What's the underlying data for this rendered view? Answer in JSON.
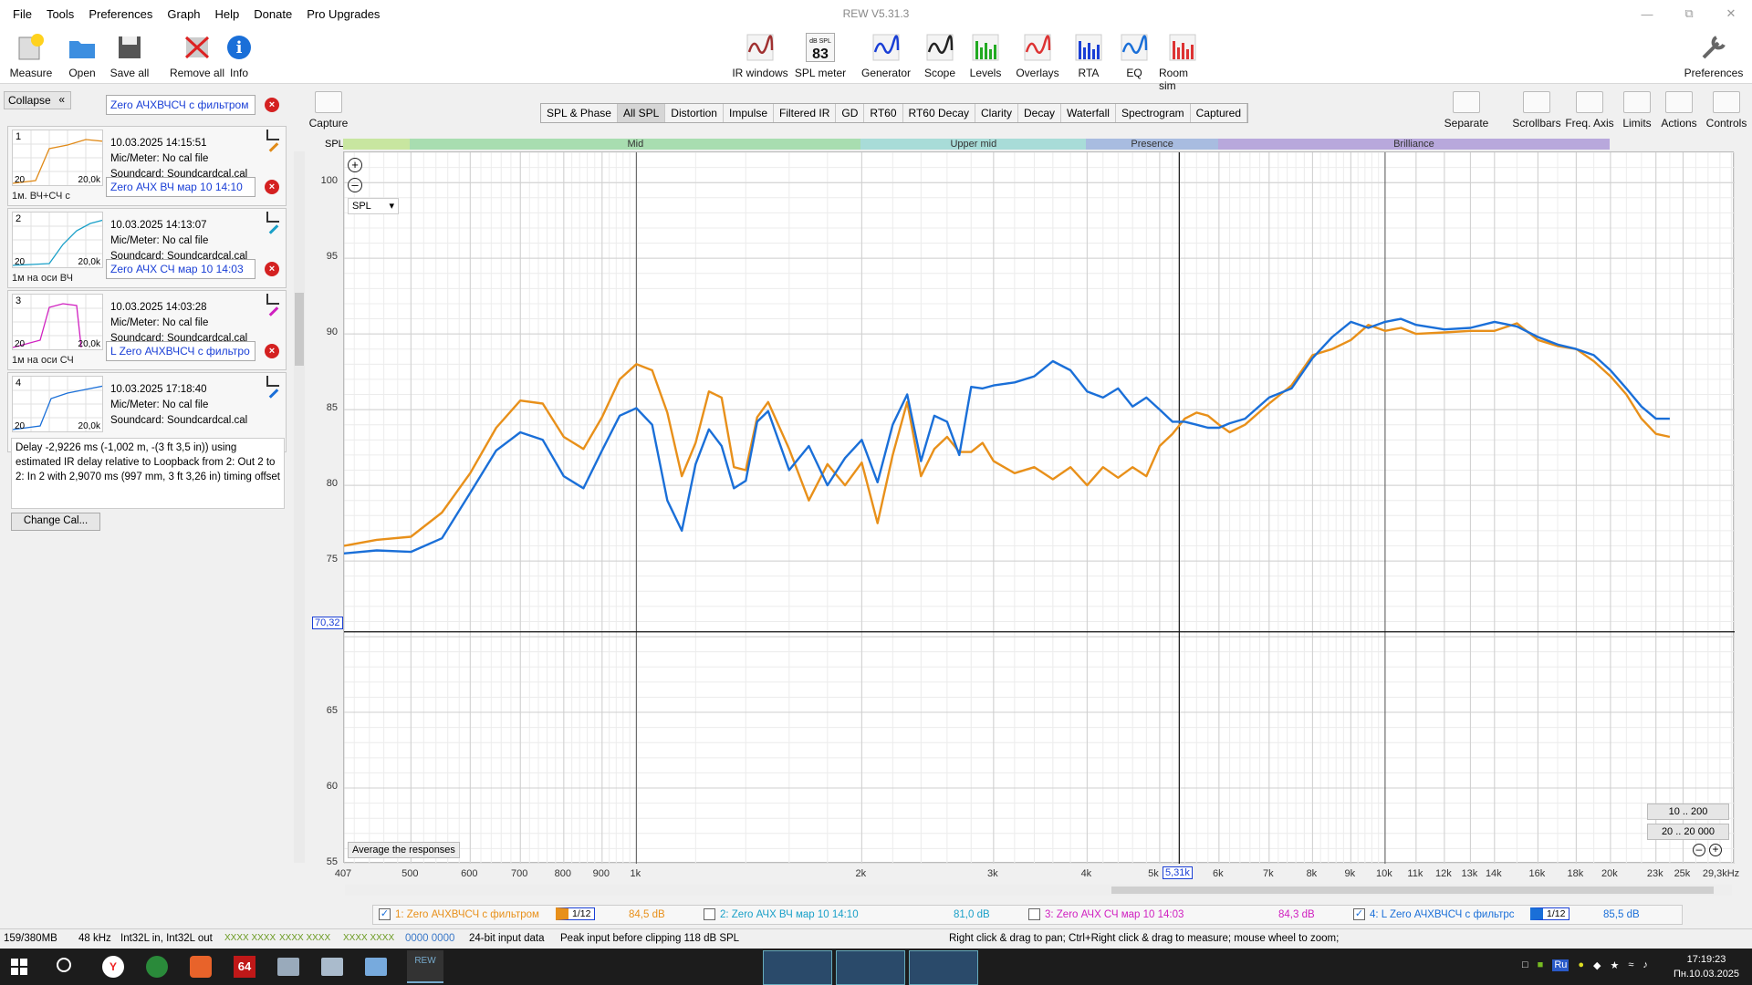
{
  "menu": [
    "File",
    "Tools",
    "Preferences",
    "Graph",
    "Help",
    "Donate",
    "Pro Upgrades"
  ],
  "window_title": "REW V5.31.3",
  "toolbar_left": [
    {
      "label": "Measure",
      "icon": "measure-icon"
    },
    {
      "label": "Open",
      "icon": "folder-icon"
    },
    {
      "label": "Save all",
      "icon": "save-icon"
    },
    {
      "label": "Remove all",
      "icon": "remove-icon"
    },
    {
      "label": "Info",
      "icon": "info-icon"
    }
  ],
  "toolbar_center": [
    {
      "label": "IR windows",
      "icon": "ir-windows-icon"
    },
    {
      "label": "SPL meter",
      "icon": "spl-meter-icon",
      "badge": "83",
      "badge_unit": "dB SPL"
    },
    {
      "label": "Generator",
      "icon": "generator-icon"
    },
    {
      "label": "Scope",
      "icon": "scope-icon"
    },
    {
      "label": "Levels",
      "icon": "levels-icon"
    },
    {
      "label": "Overlays",
      "icon": "overlays-icon"
    },
    {
      "label": "RTA",
      "icon": "rta-icon"
    },
    {
      "label": "EQ",
      "icon": "eq-icon"
    },
    {
      "label": "Room sim",
      "icon": "room-sim-icon"
    }
  ],
  "toolbar_right": {
    "label": "Preferences",
    "icon": "wrench-icon"
  },
  "graph_tools": [
    {
      "label": "Capture",
      "icon": "camera-icon"
    },
    {
      "label": "Separate",
      "icon": "separate-icon"
    },
    {
      "label": "Scrollbars",
      "icon": "scrollbars-icon"
    },
    {
      "label": "Freq. Axis",
      "icon": "freq-axis-icon"
    },
    {
      "label": "Limits",
      "icon": "limits-icon"
    },
    {
      "label": "Actions",
      "icon": "actions-icon"
    },
    {
      "label": "Controls",
      "icon": "gear-icon"
    }
  ],
  "collapse_label": "Collapse",
  "measurements": [
    {
      "num": "1",
      "name": "Zero АЧХВЧСЧ с фильтром",
      "date": "10.03.2025 14:15:51",
      "mic": "Mic/Meter: No cal file",
      "sound": "Soundcard: Soundcardcal.cal",
      "sub": "1м. ВЧ+СЧ с",
      "color": "#e08a18",
      "thumb_lo": "20",
      "thumb_hi": "20,0k"
    },
    {
      "num": "2",
      "name": "Zero АЧХ ВЧ мар 10 14:10",
      "date": "10.03.2025 14:13:07",
      "mic": "Mic/Meter: No cal file",
      "sound": "Soundcard: Soundcardcal.cal",
      "sub": "1м на оси ВЧ",
      "color": "#1aa0c8",
      "thumb_lo": "20",
      "thumb_hi": "20,0k"
    },
    {
      "num": "3",
      "name": "Zero АЧХ СЧ мар 10 14:03",
      "date": "10.03.2025 14:03:28",
      "mic": "Mic/Meter: No cal file",
      "sound": "Soundcard: Soundcardcal.cal",
      "sub": "1м на оси СЧ",
      "color": "#d020c0",
      "thumb_lo": "20",
      "thumb_hi": "20,0k"
    },
    {
      "num": "4",
      "name": "L Zero АЧХВЧСЧ с фильтро",
      "date": "10.03.2025 17:18:40",
      "mic": "Mic/Meter: No cal file",
      "sound": "Soundcard: Soundcardcal.cal",
      "sub": "",
      "color": "#1a6fd8",
      "thumb_lo": "20",
      "thumb_hi": "20,0k"
    }
  ],
  "delay_text": "Delay -2,9226 ms (-1,002 m, -(3 ft 3,5 in)) using estimated IR delay relative to Loopback from 2: Out 2 to 2: In 2 with 2,9070 ms (997 mm, 3 ft 3,26 in) timing offset",
  "change_cal": "Change Cal...",
  "tabs": [
    "SPL & Phase",
    "All SPL",
    "Distortion",
    "Impulse",
    "Filtered IR",
    "GD",
    "RT60",
    "RT60 Decay",
    "Clarity",
    "Decay",
    "Waterfall",
    "Spectrogram",
    "Captured"
  ],
  "active_tab": "All SPL",
  "spl_label": "SPL",
  "spl_select": "SPL",
  "bands": [
    {
      "label": "",
      "from": 407,
      "to": 500,
      "color": "#c8e6a0"
    },
    {
      "label": "Mid",
      "from": 500,
      "to": 2000,
      "color": "#a8ddb0"
    },
    {
      "label": "Upper mid",
      "from": 2000,
      "to": 4000,
      "color": "#a8dcd8"
    },
    {
      "label": "Presence",
      "from": 4000,
      "to": 6000,
      "color": "#a8bce0"
    },
    {
      "label": "Brilliance",
      "from": 6000,
      "to": 20000,
      "color": "#b8a8dc"
    }
  ],
  "cursor_y": "70,32",
  "cursor_x": "5,31k",
  "avg_button": "Average the responses",
  "range_buttons": [
    "10 .. 200",
    "20 .. 20 000"
  ],
  "chart_data": {
    "type": "line",
    "xlabel": "",
    "ylabel": "",
    "x_scale": "log",
    "xlim": [
      407,
      29300
    ],
    "ylim": [
      55,
      102
    ],
    "y_ticks": [
      55,
      60,
      65,
      70,
      75,
      80,
      85,
      90,
      95,
      100
    ],
    "x_ticks": [
      {
        "v": 407,
        "t": "407"
      },
      {
        "v": 500,
        "t": "500"
      },
      {
        "v": 600,
        "t": "600"
      },
      {
        "v": 700,
        "t": "700"
      },
      {
        "v": 800,
        "t": "800"
      },
      {
        "v": 900,
        "t": "900"
      },
      {
        "v": 1000,
        "t": "1k"
      },
      {
        "v": 2000,
        "t": "2k"
      },
      {
        "v": 3000,
        "t": "3k"
      },
      {
        "v": 4000,
        "t": "4k"
      },
      {
        "v": 5000,
        "t": "5k"
      },
      {
        "v": 6000,
        "t": "6k"
      },
      {
        "v": 7000,
        "t": "7k"
      },
      {
        "v": 8000,
        "t": "8k"
      },
      {
        "v": 9000,
        "t": "9k"
      },
      {
        "v": 10000,
        "t": "10k"
      },
      {
        "v": 11000,
        "t": "11k"
      },
      {
        "v": 12000,
        "t": "12k"
      },
      {
        "v": 13000,
        "t": "13k"
      },
      {
        "v": 14000,
        "t": "14k"
      },
      {
        "v": 16000,
        "t": "16k"
      },
      {
        "v": 18000,
        "t": "18k"
      },
      {
        "v": 20000,
        "t": "20k"
      },
      {
        "v": 23000,
        "t": "23k"
      },
      {
        "v": 25000,
        "t": "25k"
      },
      {
        "v": 29300,
        "t": "29,3kHz"
      }
    ],
    "series": [
      {
        "name": "1: Zero АЧХВЧСЧ с фильтром",
        "color": "#e8901a",
        "x": [
          407,
          450,
          500,
          550,
          600,
          650,
          700,
          750,
          800,
          850,
          900,
          950,
          1000,
          1050,
          1100,
          1150,
          1200,
          1250,
          1300,
          1350,
          1400,
          1450,
          1500,
          1600,
          1700,
          1800,
          1900,
          2000,
          2100,
          2200,
          2300,
          2400,
          2500,
          2600,
          2700,
          2800,
          2900,
          3000,
          3200,
          3400,
          3600,
          3800,
          4000,
          4200,
          4400,
          4600,
          4800,
          5000,
          5200,
          5400,
          5600,
          5800,
          6000,
          6200,
          6500,
          7000,
          7500,
          8000,
          8500,
          9000,
          9500,
          10000,
          10500,
          11000,
          12000,
          13000,
          14000,
          15000,
          16000,
          17000,
          18000,
          19000,
          20000,
          21000,
          22000,
          23000,
          24000
        ],
        "y": [
          76.0,
          76.4,
          76.6,
          78.2,
          80.8,
          83.8,
          85.6,
          85.4,
          83.2,
          82.4,
          84.5,
          87.0,
          88.0,
          87.6,
          84.8,
          80.6,
          82.8,
          86.2,
          85.8,
          81.2,
          81.0,
          84.5,
          85.5,
          82.4,
          79.0,
          81.4,
          80.0,
          81.5,
          77.5,
          82.0,
          85.5,
          80.6,
          82.4,
          83.2,
          82.2,
          82.2,
          82.8,
          81.6,
          80.8,
          81.2,
          80.4,
          81.2,
          80.0,
          81.2,
          80.5,
          81.2,
          80.6,
          82.6,
          83.4,
          84.4,
          84.8,
          84.6,
          84.0,
          83.5,
          84.0,
          85.4,
          86.6,
          88.6,
          89.0,
          89.6,
          90.6,
          90.2,
          90.4,
          90.0,
          90.1,
          90.2,
          90.2,
          90.7,
          89.6,
          89.2,
          89.0,
          88.2,
          87.2,
          86.0,
          84.4,
          83.4,
          83.2
        ]
      },
      {
        "name": "4: L Zero АЧХВЧСЧ с фильтро",
        "color": "#1a6fd8",
        "x": [
          407,
          450,
          500,
          550,
          600,
          650,
          700,
          750,
          800,
          850,
          900,
          950,
          1000,
          1050,
          1100,
          1150,
          1200,
          1250,
          1300,
          1350,
          1400,
          1450,
          1500,
          1600,
          1700,
          1800,
          1900,
          2000,
          2100,
          2200,
          2300,
          2400,
          2500,
          2600,
          2700,
          2800,
          2900,
          3000,
          3200,
          3400,
          3600,
          3800,
          4000,
          4200,
          4400,
          4600,
          4800,
          5000,
          5200,
          5400,
          5600,
          5800,
          6000,
          6200,
          6500,
          7000,
          7500,
          8000,
          8500,
          9000,
          9500,
          10000,
          10500,
          11000,
          12000,
          13000,
          14000,
          15000,
          16000,
          17000,
          18000,
          19000,
          20000,
          21000,
          22000,
          23000,
          24000
        ],
        "y": [
          75.5,
          75.7,
          75.6,
          76.5,
          79.5,
          82.3,
          83.5,
          83.0,
          80.6,
          79.8,
          82.3,
          84.6,
          85.1,
          84.0,
          79.0,
          77.0,
          81.4,
          83.7,
          82.6,
          79.8,
          80.3,
          84.2,
          84.9,
          81.0,
          82.6,
          80.0,
          81.8,
          83.0,
          80.2,
          84.0,
          86.0,
          81.6,
          84.6,
          84.2,
          82.0,
          86.5,
          86.4,
          86.6,
          86.8,
          87.2,
          88.2,
          87.6,
          86.2,
          85.8,
          86.4,
          85.2,
          85.8,
          85.0,
          84.2,
          84.2,
          84.0,
          83.8,
          83.8,
          84.1,
          84.4,
          85.8,
          86.4,
          88.4,
          89.8,
          90.8,
          90.4,
          90.8,
          91.0,
          90.6,
          90.3,
          90.4,
          90.8,
          90.5,
          89.8,
          89.3,
          89.0,
          88.6,
          87.6,
          86.4,
          85.2,
          84.4,
          84.4
        ]
      }
    ]
  },
  "legend": [
    {
      "check": true,
      "name": "1: Zero АЧХВЧСЧ с фильтром",
      "smooth": "1/12",
      "level": "84,5 dB",
      "color": "#e8901a"
    },
    {
      "check": false,
      "name": "2: Zero АЧХ ВЧ мар 10 14:10",
      "smooth": "",
      "level": "81,0 dB",
      "color": "#1aa0c8"
    },
    {
      "check": false,
      "name": "3: Zero АЧХ СЧ мар 10 14:03",
      "smooth": "",
      "level": "84,3 dB",
      "color": "#d020c0"
    },
    {
      "check": true,
      "name": "4: L Zero АЧХВЧСЧ с фильтрс",
      "smooth": "1/12",
      "level": "85,5 dB",
      "color": "#1a6fd8"
    }
  ],
  "status": {
    "mem": "159/380MB",
    "rate": "48 kHz",
    "format": "Int32L in, Int32L out",
    "meters1": "XXXX XXXX",
    "meters2": "XXXX XXXX",
    "meters3": "XXXX XXXX",
    "hex": "0000 0000",
    "bits": "24-bit input data",
    "peak": "Peak input before clipping 118 dB SPL",
    "hint": "Right click & drag to pan; Ctrl+Right click & drag to measure; mouse wheel to zoom;"
  },
  "taskbar": {
    "time": "17:19:23",
    "date": "Пн.10.03.2025",
    "lang": "Ru",
    "app_badge": "64",
    "app_label": "REW"
  }
}
